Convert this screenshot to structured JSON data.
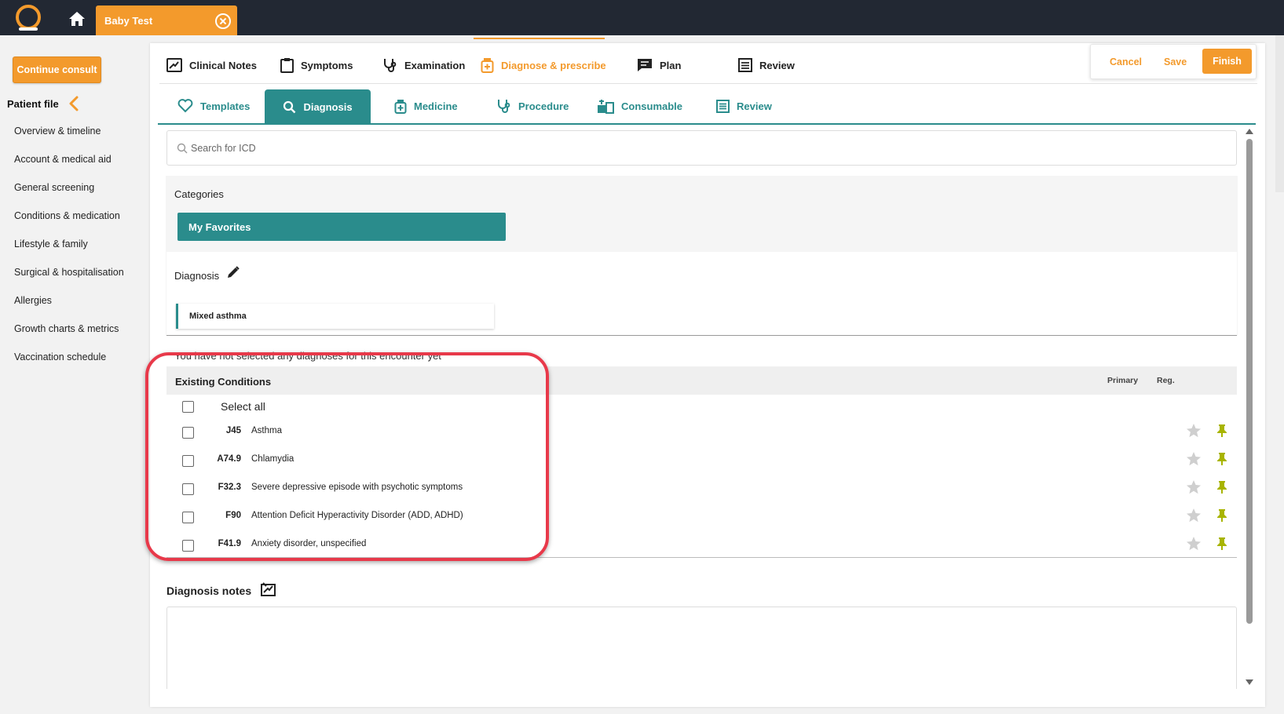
{
  "topbar": {
    "patient_tab": "Baby Test"
  },
  "sidebar": {
    "continue_button": "Continue consult",
    "patient_file_title": "Patient file",
    "items": [
      {
        "label": "Overview & timeline"
      },
      {
        "label": "Account & medical aid"
      },
      {
        "label": "General screening"
      },
      {
        "label": "Conditions & medication"
      },
      {
        "label": "Lifestyle & family"
      },
      {
        "label": "Surgical & hospitalisation"
      },
      {
        "label": "Allergies"
      },
      {
        "label": "Growth charts & metrics"
      },
      {
        "label": "Vaccination schedule"
      }
    ]
  },
  "top_tabs": [
    {
      "label": "Clinical Notes",
      "icon": "clinical-notes-icon"
    },
    {
      "label": "Symptoms",
      "icon": "clipboard-icon"
    },
    {
      "label": "Examination",
      "icon": "stethoscope-icon"
    },
    {
      "label": "Diagnose & prescribe",
      "icon": "medicine-bottle-icon",
      "active": true
    },
    {
      "label": "Plan",
      "icon": "chat-icon"
    },
    {
      "label": "Review",
      "icon": "list-icon"
    }
  ],
  "actions": {
    "cancel": "Cancel",
    "save": "Save",
    "finish": "Finish"
  },
  "sub_tabs": [
    {
      "label": "Templates",
      "icon": "heart-icon"
    },
    {
      "label": "Diagnosis",
      "icon": "search-icon",
      "active": true
    },
    {
      "label": "Medicine",
      "icon": "medicine-icon"
    },
    {
      "label": "Procedure",
      "icon": "stethoscope-icon"
    },
    {
      "label": "Consumable",
      "icon": "consumable-icon"
    },
    {
      "label": "Review",
      "icon": "list-icon"
    }
  ],
  "search": {
    "placeholder": "Search for ICD",
    "value": ""
  },
  "categories": {
    "label": "Categories",
    "favorites_button": "My Favorites"
  },
  "diagnosis": {
    "label": "Diagnosis",
    "selected": [
      "Mixed asthma"
    ],
    "empty_message": "You have not selected any diagnoses for this encounter yet"
  },
  "existing_conditions": {
    "title": "Existing Conditions",
    "col_primary": "Primary",
    "col_reg": "Reg.",
    "select_all": "Select all",
    "rows": [
      {
        "code": "J45",
        "name": "Asthma"
      },
      {
        "code": "A74.9",
        "name": "Chlamydia"
      },
      {
        "code": "F32.3",
        "name": "Severe depressive episode with psychotic symptoms"
      },
      {
        "code": "F90",
        "name": "Attention Deficit Hyperactivity Disorder (ADD, ADHD)"
      },
      {
        "code": "F41.9",
        "name": "Anxiety disorder, unspecified"
      }
    ]
  },
  "notes": {
    "label": "Diagnosis notes",
    "value": ""
  },
  "colors": {
    "accent": "#f39a2c",
    "teal": "#2a8c8c",
    "topbar": "#222833",
    "highlight": "#e8394a",
    "pin": "#a8b400"
  }
}
